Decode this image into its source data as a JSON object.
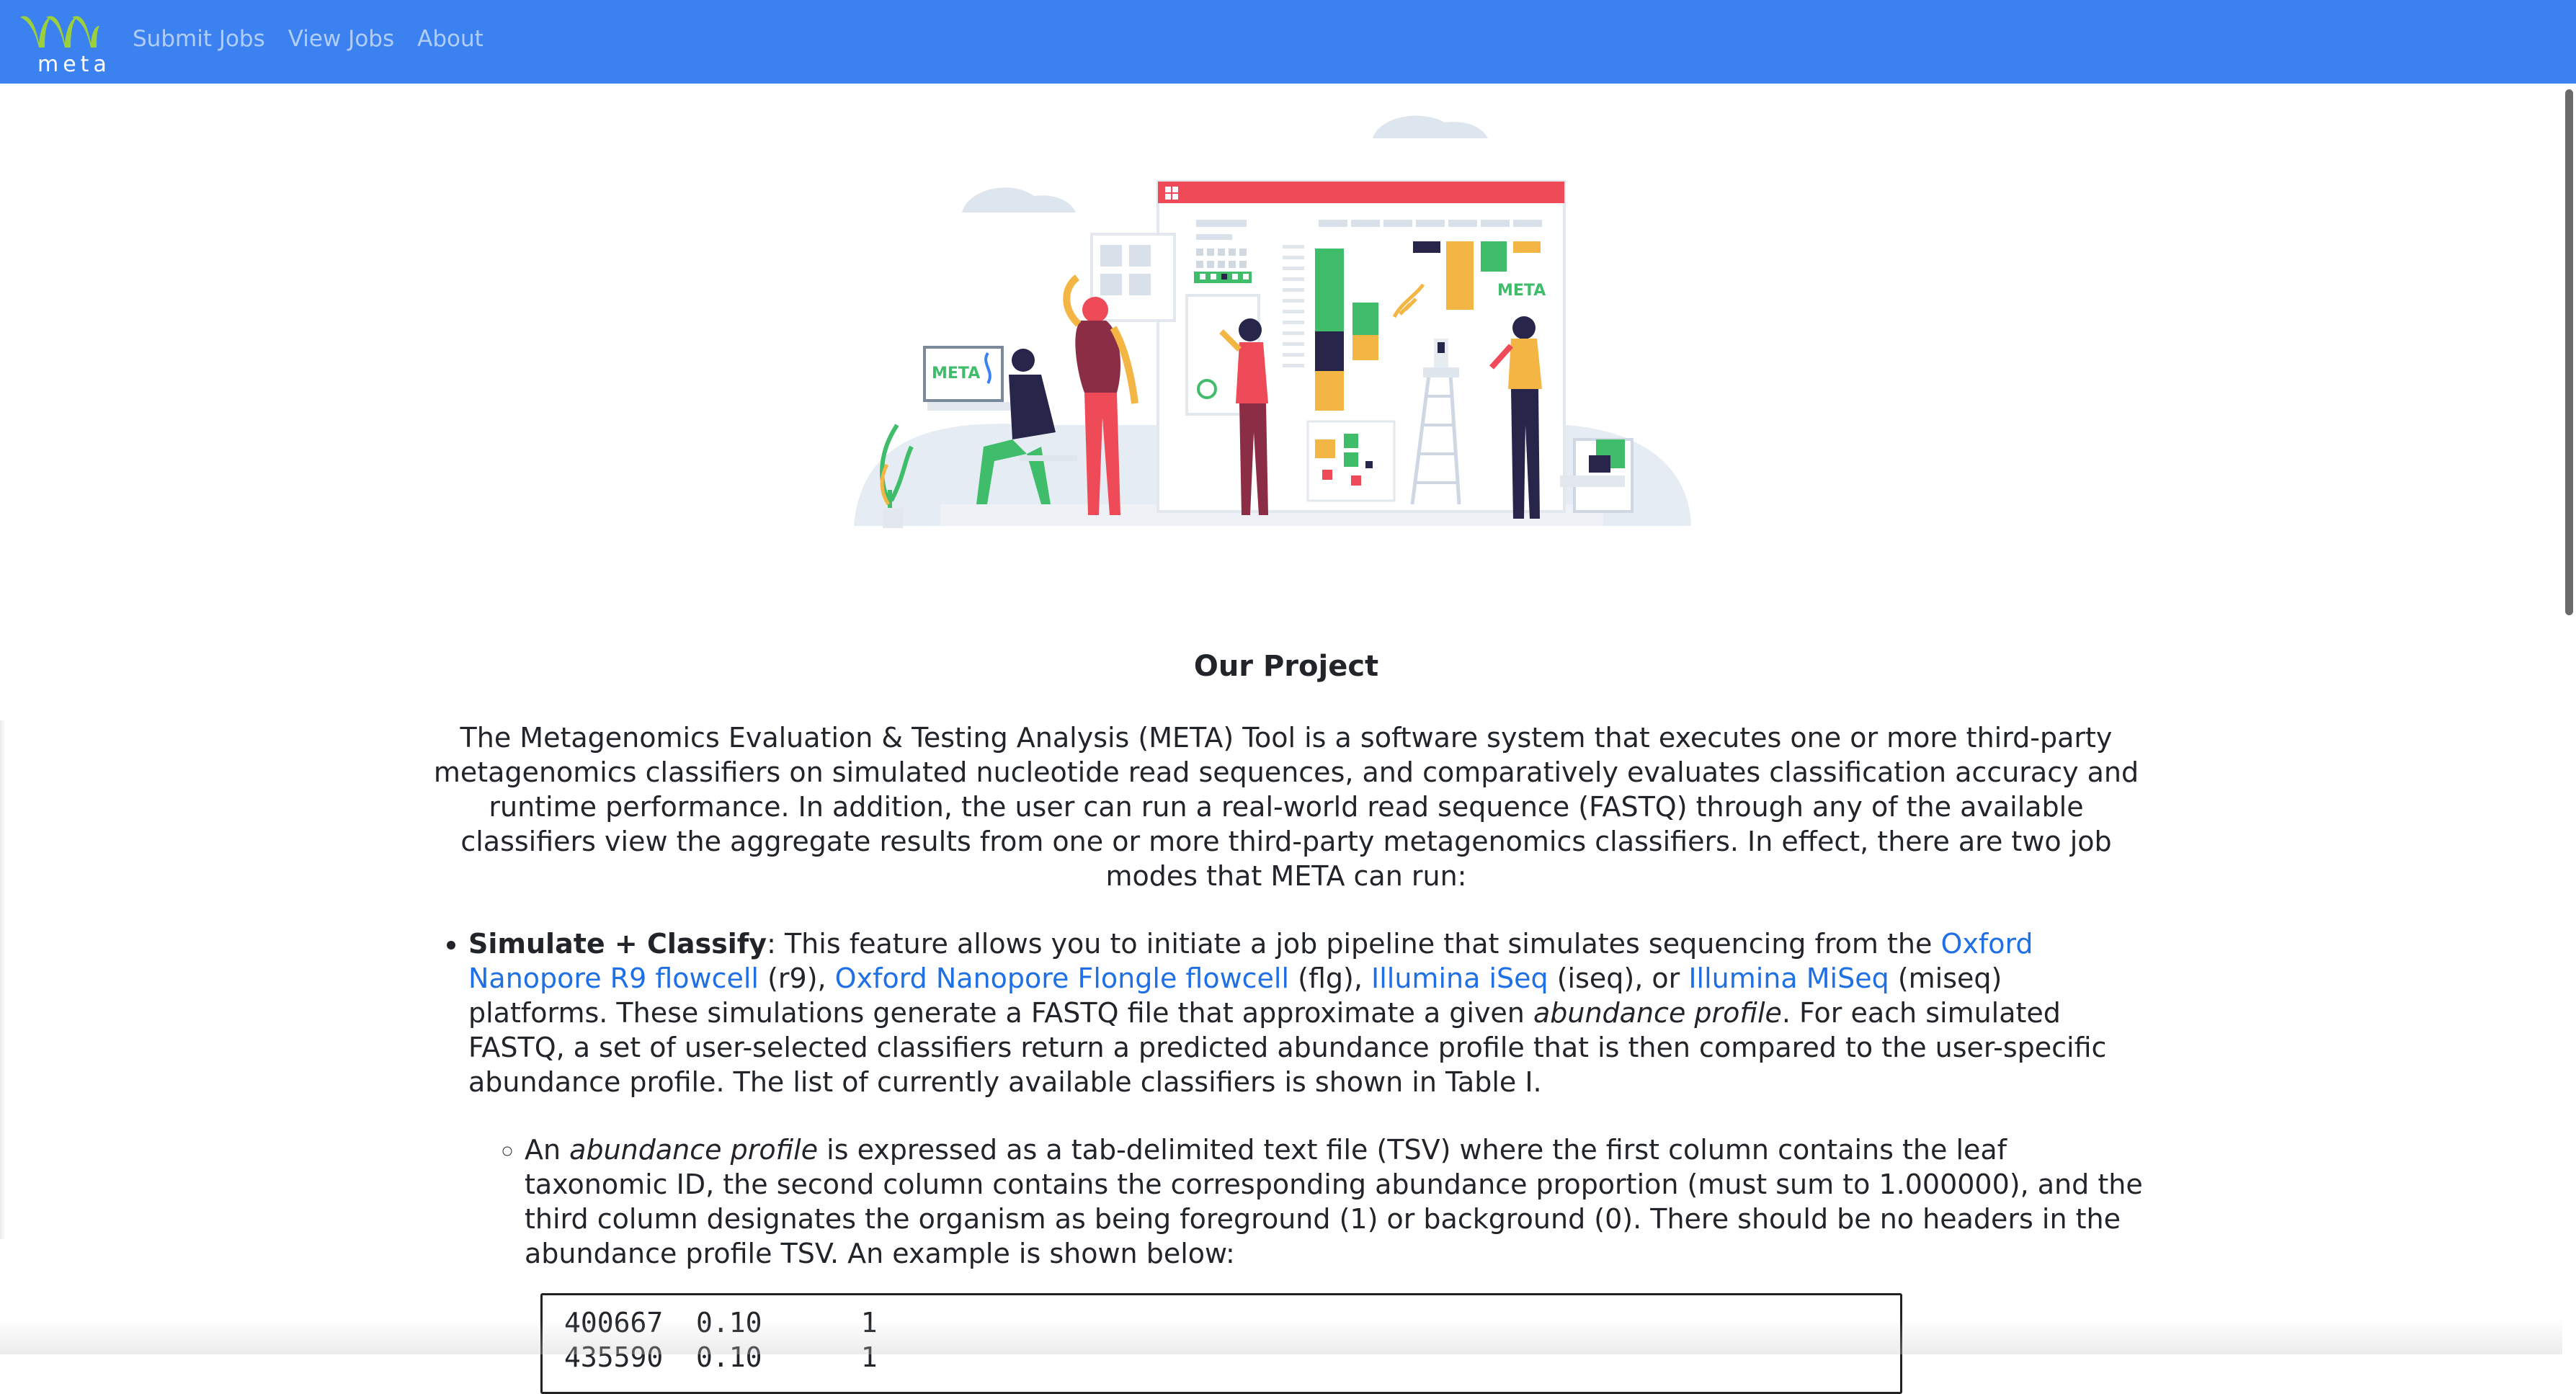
{
  "brand": {
    "text": "meta"
  },
  "nav": {
    "items": [
      {
        "label": "Submit Jobs"
      },
      {
        "label": "View Jobs"
      },
      {
        "label": "About"
      }
    ]
  },
  "hero": {
    "label_left": "META",
    "label_right": "META"
  },
  "colors": {
    "navbar": "#3b82f0",
    "brand_green": "#9ccf3c",
    "link": "#1f6fe5",
    "hero_red": "#ef4a57",
    "hero_green": "#3fbd6b",
    "hero_yellow": "#f3b544",
    "hero_navy": "#27264a"
  },
  "content": {
    "title": "Our Project",
    "intro": "The Metagenomics Evaluation & Testing Analysis (META) Tool is a software system that executes one or more third-party metagenomics classifiers on simulated nucleotide read sequences, and comparatively evaluates classification accuracy and runtime performance. In addition, the user can run a real-world read sequence (FASTQ) through any of the available classifiers view the aggregate results from one or more third-party metagenomics classifiers. In effect, there are two job modes that META can run:",
    "bullet1": {
      "label": "Simulate + Classify",
      "text_a": ": This feature allows you to initiate a job pipeline that simulates sequencing from the ",
      "link_r9": "Oxford Nanopore R9 flowcell",
      "text_b": " (r9), ",
      "link_flg": "Oxford Nanopore Flongle flowcell",
      "text_c": " (flg), ",
      "link_iseq": "Illumina iSeq",
      "text_d": " (iseq), or ",
      "link_miseq": "Illumina MiSeq",
      "text_e": " (miseq) platforms. These simulations generate a FASTQ file that approximate a given ",
      "em": "abundance profile",
      "text_f": ". For each simulated FASTQ, a set of user-selected classifiers return a predicted abundance profile that is then compared to the user-specific abundance profile. The list of currently available classifiers is shown in Table I."
    },
    "subbullet": {
      "text_a": "An ",
      "em": "abundance profile",
      "text_b": " is expressed as a tab-delimited text file (TSV) where the first column contains the leaf taxonomic ID, the second column contains the corresponding abundance proportion (must sum to 1.000000), and the third column designates the organism as being foreground (1) or background (0). There should be no headers in the abundance profile TSV. An example is shown below:"
    },
    "code": {
      "row1": "400667  0.10      1",
      "row2": "435590  0.10      1"
    }
  }
}
